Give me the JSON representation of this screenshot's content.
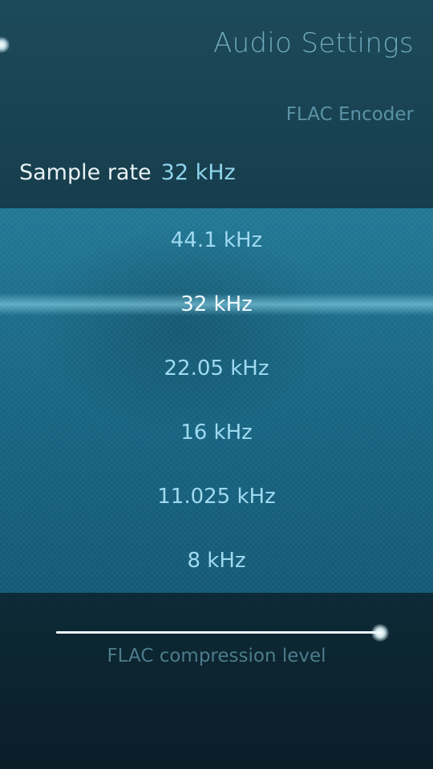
{
  "page": {
    "title": "Audio Settings",
    "section_header": "FLAC Encoder"
  },
  "sample_rate": {
    "label": "Sample rate",
    "value": "32 kHz",
    "options": [
      "44.1 kHz",
      "32 kHz",
      "22.05 kHz",
      "16 kHz",
      "11.025 kHz",
      "8 kHz"
    ],
    "selected_index": 1
  },
  "compression_slider": {
    "label": "FLAC compression level",
    "level_fraction": 1.0
  },
  "colors": {
    "accent": "#8fd4ec",
    "menu_background": "#1e7393",
    "background": "#163d4c"
  }
}
